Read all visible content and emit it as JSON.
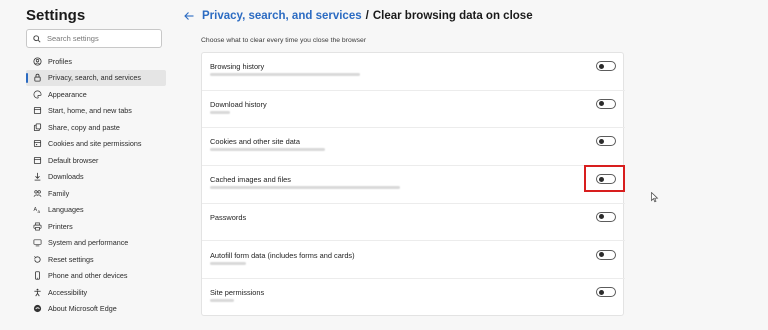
{
  "sidebar": {
    "title": "Settings",
    "search_placeholder": "Search settings",
    "items": [
      {
        "label": "Profiles",
        "icon": "profile-icon",
        "active": false
      },
      {
        "label": "Privacy, search, and services",
        "icon": "lock-icon",
        "active": true
      },
      {
        "label": "Appearance",
        "icon": "appearance-icon",
        "active": false
      },
      {
        "label": "Start, home, and new tabs",
        "icon": "home-icon",
        "active": false
      },
      {
        "label": "Share, copy and paste",
        "icon": "share-icon",
        "active": false
      },
      {
        "label": "Cookies and site permissions",
        "icon": "cookie-icon",
        "active": false
      },
      {
        "label": "Default browser",
        "icon": "browser-icon",
        "active": false
      },
      {
        "label": "Downloads",
        "icon": "download-icon",
        "active": false
      },
      {
        "label": "Family",
        "icon": "family-icon",
        "active": false
      },
      {
        "label": "Languages",
        "icon": "language-icon",
        "active": false
      },
      {
        "label": "Printers",
        "icon": "printer-icon",
        "active": false
      },
      {
        "label": "System and performance",
        "icon": "system-icon",
        "active": false
      },
      {
        "label": "Reset settings",
        "icon": "reset-icon",
        "active": false
      },
      {
        "label": "Phone and other devices",
        "icon": "phone-icon",
        "active": false
      },
      {
        "label": "Accessibility",
        "icon": "accessibility-icon",
        "active": false
      },
      {
        "label": "About Microsoft Edge",
        "icon": "edge-icon",
        "active": false
      }
    ]
  },
  "breadcrumb": {
    "parent": "Privacy, search, and services",
    "separator": "/",
    "current": "Clear browsing data on close"
  },
  "subtitle": "Choose what to clear every time you close the browser",
  "options": [
    {
      "label": "Browsing history",
      "enabled": false
    },
    {
      "label": "Download history",
      "enabled": false
    },
    {
      "label": "Cookies and other site data",
      "enabled": false
    },
    {
      "label": "Cached images and files",
      "enabled": false,
      "highlighted": true
    },
    {
      "label": "Passwords",
      "enabled": false
    },
    {
      "label": "Autofill form data (includes forms and cards)",
      "enabled": false
    },
    {
      "label": "Site permissions",
      "enabled": false
    }
  ],
  "colors": {
    "accent": "#2b6bc2",
    "highlight": "#d81e1e",
    "background": "#f7f7f7"
  }
}
